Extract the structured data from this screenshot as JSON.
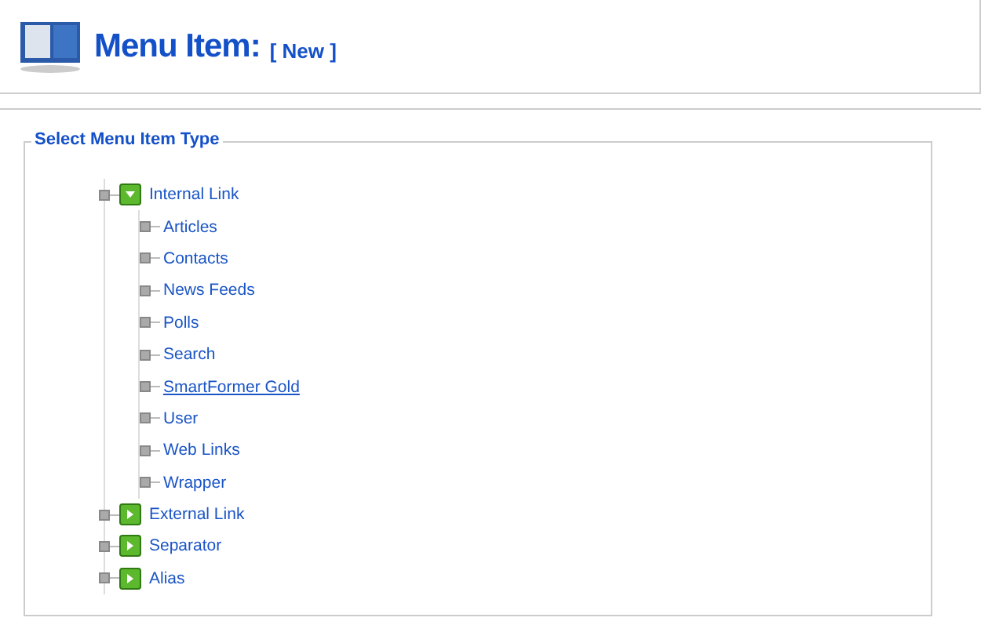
{
  "header": {
    "title": "Menu Item:",
    "subtitle": "[ New ]"
  },
  "panel": {
    "legend": "Select Menu Item Type"
  },
  "tree": [
    {
      "label": "Internal Link",
      "expanded": true,
      "children": [
        {
          "label": "Articles",
          "hovered": false
        },
        {
          "label": "Contacts",
          "hovered": false
        },
        {
          "label": "News Feeds",
          "hovered": false
        },
        {
          "label": "Polls",
          "hovered": false
        },
        {
          "label": "Search",
          "hovered": false
        },
        {
          "label": "SmartFormer Gold",
          "hovered": true
        },
        {
          "label": "User",
          "hovered": false
        },
        {
          "label": "Web Links",
          "hovered": false
        },
        {
          "label": "Wrapper",
          "hovered": false
        }
      ]
    },
    {
      "label": "External Link",
      "expanded": false
    },
    {
      "label": "Separator",
      "expanded": false
    },
    {
      "label": "Alias",
      "expanded": false
    }
  ]
}
